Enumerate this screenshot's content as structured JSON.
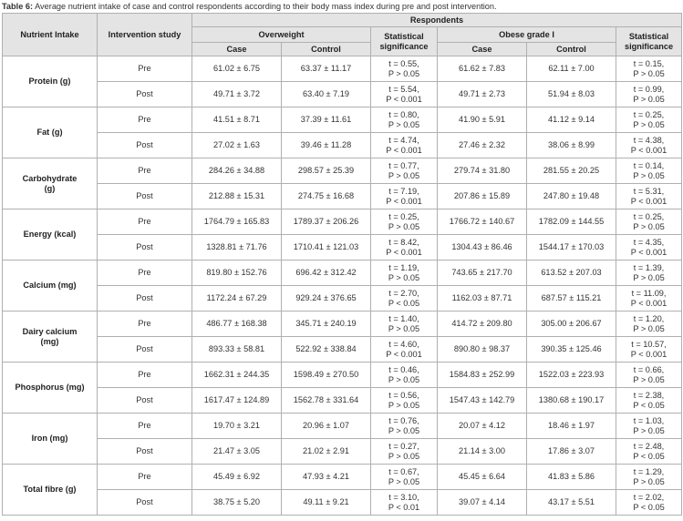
{
  "caption": {
    "label": "Table 6:",
    "text": " Average nutrient intake of case and control respondents according to their body mass index during pre and post intervention."
  },
  "headers": {
    "nutrient": "Nutrient Intake",
    "intervention": "Intervention study",
    "respondents": "Respondents",
    "overweight": "Overweight",
    "obese": "Obese grade I",
    "case": "Case",
    "control": "Control",
    "stat1": "Statistical",
    "stat2": "significance"
  },
  "rows": [
    {
      "nutrient": [
        "Protein (g)"
      ],
      "pre": {
        "label": "Pre",
        "ow_case": "61.02 ± 6.75",
        "ow_control": "63.37 ± 11.17",
        "ow_stat": [
          "t = 0.55,",
          "P > 0.05"
        ],
        "ob_case": "61.62 ± 7.83",
        "ob_control": "62.11 ± 7.00",
        "ob_stat": [
          "t = 0.15,",
          "P > 0.05"
        ]
      },
      "post": {
        "label": "Post",
        "ow_case": "49.71 ± 3.72",
        "ow_control": "63.40 ± 7.19",
        "ow_stat": [
          "t = 5.54,",
          "P < 0.001"
        ],
        "ob_case": "49.71 ± 2.73",
        "ob_control": "51.94 ± 8.03",
        "ob_stat": [
          "t = 0.99,",
          "P > 0.05"
        ]
      }
    },
    {
      "nutrient": [
        "Fat (g)"
      ],
      "pre": {
        "label": "Pre",
        "ow_case": "41.51 ± 8.71",
        "ow_control": "37.39 ± 11.61",
        "ow_stat": [
          "t = 0.80,",
          "P > 0.05"
        ],
        "ob_case": "41.90 ± 5.91",
        "ob_control": "41.12 ± 9.14",
        "ob_stat": [
          "t = 0.25,",
          "P > 0.05"
        ]
      },
      "post": {
        "label": "Post",
        "ow_case": "27.02 ± 1.63",
        "ow_control": "39.46 ± 11.28",
        "ow_stat": [
          "t = 4.74,",
          "P < 0.001"
        ],
        "ob_case": "27.46 ± 2.32",
        "ob_control": "38.06 ± 8.99",
        "ob_stat": [
          "t = 4.38,",
          "P < 0.001"
        ]
      }
    },
    {
      "nutrient": [
        "Carbohydrate",
        "(g)"
      ],
      "pre": {
        "label": "Pre",
        "ow_case": "284.26 ± 34.88",
        "ow_control": "298.57 ± 25.39",
        "ow_stat": [
          "t = 0.77,",
          "P > 0.05"
        ],
        "ob_case": "279.74 ± 31.80",
        "ob_control": "281.55 ± 20.25",
        "ob_stat": [
          "t = 0.14,",
          "P > 0.05"
        ]
      },
      "post": {
        "label": "Post",
        "ow_case": "212.88 ± 15.31",
        "ow_control": "274.75 ± 16.68",
        "ow_stat": [
          "t = 7.19,",
          "P < 0.001"
        ],
        "ob_case": "207.86 ± 15.89",
        "ob_control": "247.80 ± 19.48",
        "ob_stat": [
          "t = 5.31,",
          "P < 0.001"
        ]
      }
    },
    {
      "nutrient": [
        "Energy (kcal)"
      ],
      "pre": {
        "label": "Pre",
        "ow_case": "1764.79 ± 165.83",
        "ow_control": "1789.37 ± 206.26",
        "ow_stat": [
          "t = 0.25,",
          "P > 0.05"
        ],
        "ob_case": "1766.72 ± 140.67",
        "ob_control": "1782.09 ± 144.55",
        "ob_stat": [
          "t = 0.25,",
          "P > 0.05"
        ]
      },
      "post": {
        "label": "Post",
        "ow_case": "1328.81 ± 71.76",
        "ow_control": "1710.41 ± 121.03",
        "ow_stat": [
          "t = 8.42,",
          "P < 0.001"
        ],
        "ob_case": "1304.43 ± 86.46",
        "ob_control": "1544.17 ± 170.03",
        "ob_stat": [
          "t = 4.35,",
          "P < 0.001"
        ]
      }
    },
    {
      "nutrient": [
        "Calcium (mg)"
      ],
      "pre": {
        "label": "Pre",
        "ow_case": "819.80 ± 152.76",
        "ow_control": "696.42 ± 312.42",
        "ow_stat": [
          "t = 1.19,",
          "P > 0.05"
        ],
        "ob_case": "743.65 ± 217.70",
        "ob_control": "613.52 ± 207.03",
        "ob_stat": [
          "t = 1.39,",
          "P > 0.05"
        ]
      },
      "post": {
        "label": "Post",
        "ow_case": "1172.24 ± 67.29",
        "ow_control": "929.24 ± 376.65",
        "ow_stat": [
          "t = 2.70,",
          "P < 0.05"
        ],
        "ob_case": "1162.03 ± 87.71",
        "ob_control": "687.57 ± 115.21",
        "ob_stat": [
          "t = 11.09,",
          "P < 0.001"
        ]
      }
    },
    {
      "nutrient": [
        "Dairy calcium",
        "(mg)"
      ],
      "pre": {
        "label": "Pre",
        "ow_case": "486.77 ± 168.38",
        "ow_control": "345.71 ± 240.19",
        "ow_stat": [
          "t = 1.40,",
          "P > 0.05"
        ],
        "ob_case": "414.72 ± 209.80",
        "ob_control": "305.00 ± 206.67",
        "ob_stat": [
          "t = 1.20,",
          "P > 0.05"
        ]
      },
      "post": {
        "label": "Post",
        "ow_case": "893.33 ± 58.81",
        "ow_control": "522.92 ± 338.84",
        "ow_stat": [
          "t = 4.60,",
          "P < 0.001"
        ],
        "ob_case": "890.80 ± 98.37",
        "ob_control": "390.35 ± 125.46",
        "ob_stat": [
          "t = 10.57,",
          "P < 0.001"
        ]
      }
    },
    {
      "nutrient": [
        "Phosphorus (mg)"
      ],
      "pre": {
        "label": "Pre",
        "ow_case": "1662.31 ± 244.35",
        "ow_control": "1598.49 ± 270.50",
        "ow_stat": [
          "t = 0.46,",
          "P > 0.05"
        ],
        "ob_case": "1584.83 ± 252.99",
        "ob_control": "1522.03 ± 223.93",
        "ob_stat": [
          "t = 0.66,",
          "P > 0.05"
        ]
      },
      "post": {
        "label": "Post",
        "ow_case": "1617.47 ± 124.89",
        "ow_control": "1562.78 ± 331.64",
        "ow_stat": [
          "t = 0.56,",
          "P > 0.05"
        ],
        "ob_case": "1547.43 ± 142.79",
        "ob_control": "1380.68 ± 190.17",
        "ob_stat": [
          "t = 2.38,",
          "P < 0.05"
        ]
      }
    },
    {
      "nutrient": [
        "Iron (mg)"
      ],
      "pre": {
        "label": "Pre",
        "ow_case": "19.70 ± 3.21",
        "ow_control": "20.96 ± 1.07",
        "ow_stat": [
          "t = 0.76,",
          "P > 0.05"
        ],
        "ob_case": "20.07 ± 4.12",
        "ob_control": "18.46 ± 1.97",
        "ob_stat": [
          "t = 1.03,",
          "P > 0.05"
        ]
      },
      "post": {
        "label": "Post",
        "ow_case": "21.47 ± 3.05",
        "ow_control": "21.02 ± 2.91",
        "ow_stat": [
          "t = 0.27,",
          "P > 0.05"
        ],
        "ob_case": "21.14 ± 3.00",
        "ob_control": "17.86 ± 3.07",
        "ob_stat": [
          "t = 2.48,",
          "P < 0.05"
        ]
      }
    },
    {
      "nutrient": [
        "Total fibre (g)"
      ],
      "pre": {
        "label": "Pre",
        "ow_case": "45.49 ± 6.92",
        "ow_control": "47.93 ± 4.21",
        "ow_stat": [
          "t = 0.67,",
          "P > 0.05"
        ],
        "ob_case": "45.45 ± 6.64",
        "ob_control": "41.83 ± 5.86",
        "ob_stat": [
          "t = 1.29,",
          "P > 0.05"
        ]
      },
      "post": {
        "label": "Post",
        "ow_case": "38.75 ± 5.20",
        "ow_control": "49.11 ± 9.21",
        "ow_stat": [
          "t = 3.10,",
          "P < 0.01"
        ],
        "ob_case": "39.07 ± 4.14",
        "ob_control": "43.17 ± 5.51",
        "ob_stat": [
          "t = 2.02,",
          "P < 0.05"
        ]
      }
    }
  ]
}
